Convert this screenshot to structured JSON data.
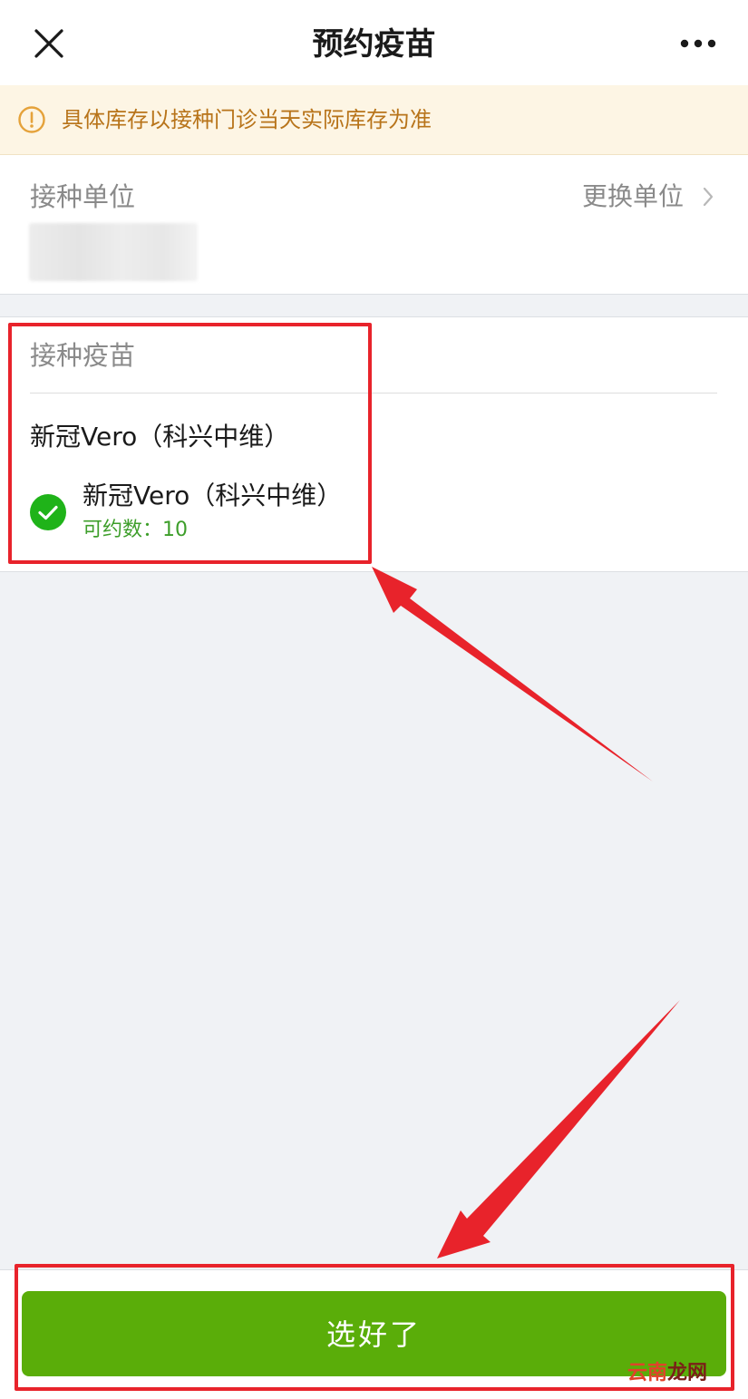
{
  "nav": {
    "title": "预约疫苗",
    "close_icon": "close-icon",
    "more_icon": "more-icon"
  },
  "notice": {
    "icon": "warning-icon",
    "text": "具体库存以接种门诊当天实际库存为准",
    "color": "#b8741a",
    "background": "#fdf5e4"
  },
  "unit": {
    "label": "接种单位",
    "change_label": "更换单位"
  },
  "vaccine": {
    "label": "接种疫苗",
    "group_name": "新冠Vero（科兴中维）",
    "options": [
      {
        "name": "新冠Vero（科兴中维）",
        "availability": "可约数：10",
        "selected": true
      }
    ]
  },
  "footer": {
    "confirm_label": "选好了",
    "button_color": "#5aad09"
  },
  "annotation_color": "#e8232b",
  "watermark": {
    "part1": "云南",
    "part2": "龙网"
  }
}
